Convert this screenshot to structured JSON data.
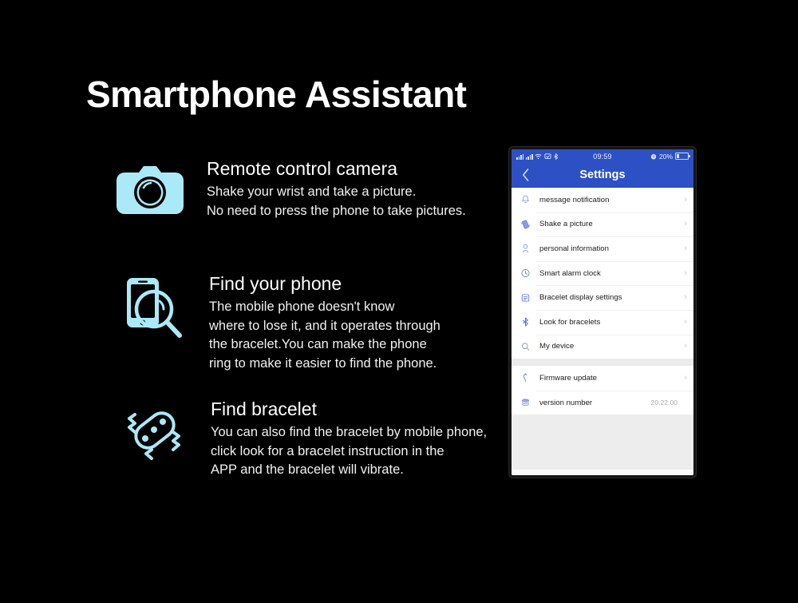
{
  "page": {
    "title": "Smartphone Assistant",
    "background_color": "#000000",
    "accent_color": "#aae9f7"
  },
  "features": [
    {
      "icon": "camera-icon",
      "heading": "Remote control camera",
      "body": "Shake your wrist and take a picture.\nNo need to press the phone to take pictures."
    },
    {
      "icon": "find-phone-icon",
      "heading": "Find your phone",
      "body": "The mobile phone doesn't know\nwhere to lose it, and it operates through\nthe bracelet.You can make the phone\nring to make it easier to find the phone."
    },
    {
      "icon": "find-bracelet-icon",
      "heading": "Find bracelet",
      "body": "You can also find the bracelet by mobile phone,\n click  look for a bracelet instruction in the\nAPP and the bracelet will vibrate."
    }
  ],
  "phone": {
    "status_bar": {
      "time": "09:59",
      "battery_percent": "20%",
      "header_color": "#2d51c4"
    },
    "nav": {
      "back_icon": "chevron-left-icon",
      "title": "Settings"
    },
    "settings_groups": [
      {
        "rows": [
          {
            "icon": "bell-icon",
            "label": "message notification",
            "value": "",
            "chevron": "›"
          },
          {
            "icon": "shake-icon",
            "label": "Shake a picture",
            "value": "",
            "chevron": "›"
          },
          {
            "icon": "person-icon",
            "label": "personal information",
            "value": "",
            "chevron": "›"
          },
          {
            "icon": "clock-icon",
            "label": "Smart alarm clock",
            "value": "",
            "chevron": "›"
          },
          {
            "icon": "display-icon",
            "label": "Bracelet display settings",
            "value": "",
            "chevron": "›"
          },
          {
            "icon": "bluetooth-icon",
            "label": "Look for bracelets",
            "value": "",
            "chevron": "›"
          },
          {
            "icon": "search-icon",
            "label": "My device",
            "value": "",
            "chevron": "›"
          }
        ]
      },
      {
        "rows": [
          {
            "icon": "upload-icon",
            "label": "Firmware update",
            "value": "",
            "chevron": "›"
          },
          {
            "icon": "layers-icon",
            "label": "version number",
            "value": "20.22.00",
            "chevron": ""
          }
        ]
      }
    ]
  }
}
